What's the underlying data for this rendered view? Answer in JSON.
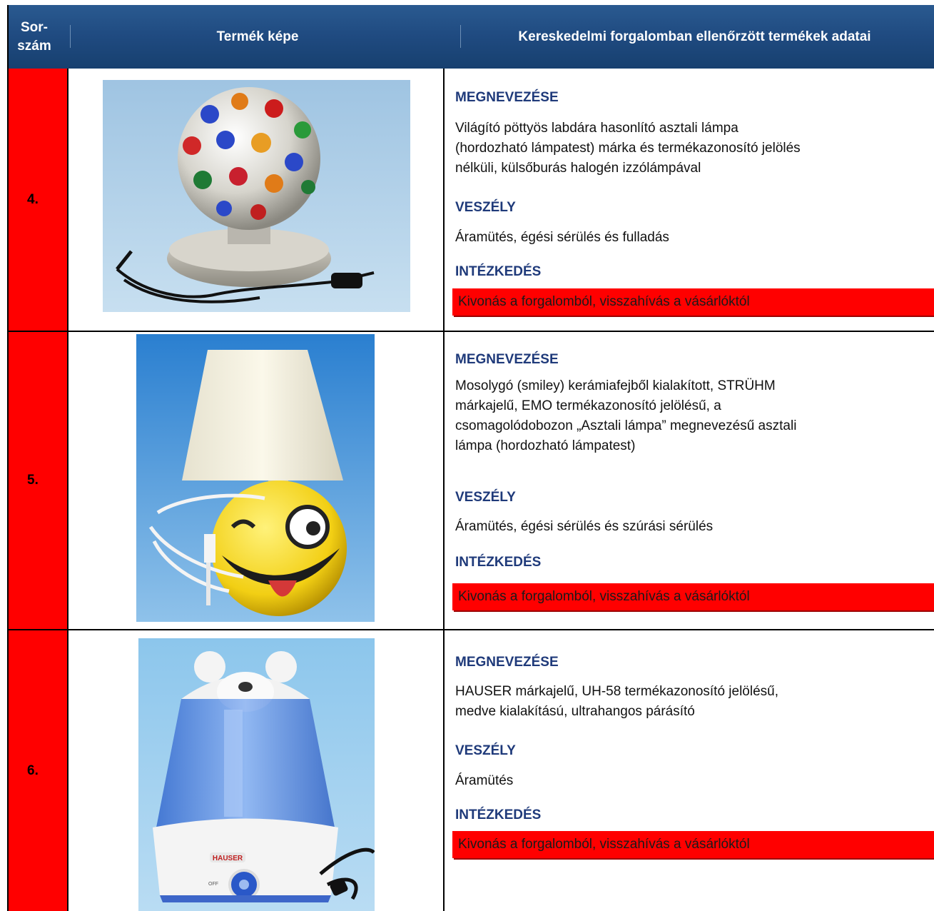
{
  "header": {
    "col_number": "Sor-szám",
    "col_number_line1": "Sor-",
    "col_number_line2": "szám",
    "col_image": "Termék képe",
    "col_data": "Kereskedelmi forgalomban ellenőrzött termékek adatai"
  },
  "rows": [
    {
      "number": "4.",
      "name_heading": "MEGNEVEZÉSE",
      "name_lines": [
        "Világító pöttyös labdára hasonlító asztali lámpa",
        "(hordozható lámpatest) márka és termékazonosító jelölés",
        "nélküli, külsőburás halogén izzólámpával"
      ],
      "danger_heading": "VESZÉLY",
      "danger": "Áramütés, égési sérülés és fulladás",
      "action_heading": "INTÉZKEDÉS",
      "action": "Kivonás a forgalomból, visszahívás a vásárlóktól",
      "image": "disco-ball-lamp-photo"
    },
    {
      "number": "5.",
      "name_heading": "MEGNEVEZÉSE",
      "name_lines": [
        "Mosolygó (smiley) kerámiafejből kialakított, STRÜHM",
        "márkajelű, EMO termékazonosító jelölésű, a",
        "csomagolódobozon „Asztali lámpa” megnevezésű asztali",
        "lámpa (hordozható lámpatest)"
      ],
      "danger_heading": "VESZÉLY",
      "danger": "Áramütés, égési sérülés és szúrási sérülés",
      "action_heading": "INTÉZKEDÉS",
      "action": "Kivonás a forgalomból, visszahívás a vásárlóktól",
      "image": "smiley-lamp-photo"
    },
    {
      "number": "6.",
      "name_heading": "MEGNEVEZÉSE",
      "name_lines": [
        "HAUSER márkajelű, UH-58 termékazonosító jelölésű,",
        "medve kialakítású, ultrahangos párásító"
      ],
      "danger_heading": "VESZÉLY",
      "danger": "Áramütés",
      "action_heading": "INTÉZKEDÉS",
      "action": "Kivonás a forgalomból, visszahívás a vásárlóktól",
      "image": "bear-humidifier-photo",
      "brand_label": "HAUSER",
      "dial_label": "OFF"
    }
  ],
  "colors": {
    "header_blue": "#1f4a80",
    "number_red": "#ff0000",
    "heading_blue": "#1f3a7a"
  }
}
